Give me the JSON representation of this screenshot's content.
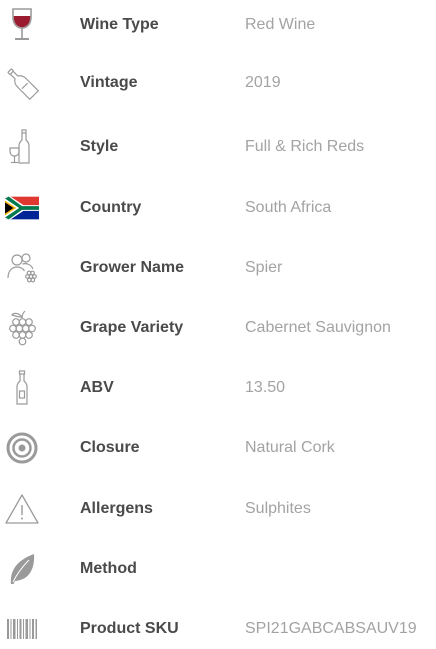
{
  "specs": [
    {
      "label": "Wine Type",
      "value": "Red Wine",
      "icon": "wine-glass-icon"
    },
    {
      "label": "Vintage",
      "value": "2019",
      "icon": "wine-bottle-icon"
    },
    {
      "label": "Style",
      "value": "Full & Rich Reds",
      "icon": "bottle-and-glass-icon"
    },
    {
      "label": "Country",
      "value": "South Africa",
      "icon": "south-africa-flag-icon"
    },
    {
      "label": "Grower Name",
      "value": "Spier",
      "icon": "growers-icon"
    },
    {
      "label": "Grape Variety",
      "value": "Cabernet Sauvignon",
      "icon": "grapes-icon"
    },
    {
      "label": "ABV",
      "value": "13.50",
      "icon": "bottle-icon"
    },
    {
      "label": "Closure",
      "value": "Natural Cork",
      "icon": "cork-icon"
    },
    {
      "label": "Allergens",
      "value": "Sulphites",
      "icon": "warning-icon"
    },
    {
      "label": "Method",
      "value": "",
      "icon": "leaf-icon"
    },
    {
      "label": "Product SKU",
      "value": "SPI21GABCABSAUV19",
      "icon": "barcode-icon"
    }
  ],
  "colors": {
    "wine_red": "#9b1b30",
    "label_text": "#4a4a4a",
    "value_text": "#a3a3a3",
    "icon_grey": "#9a9a9a",
    "flag_green": "#007a4d",
    "flag_red": "#de3831",
    "flag_blue": "#002395",
    "flag_gold": "#ffb612"
  }
}
